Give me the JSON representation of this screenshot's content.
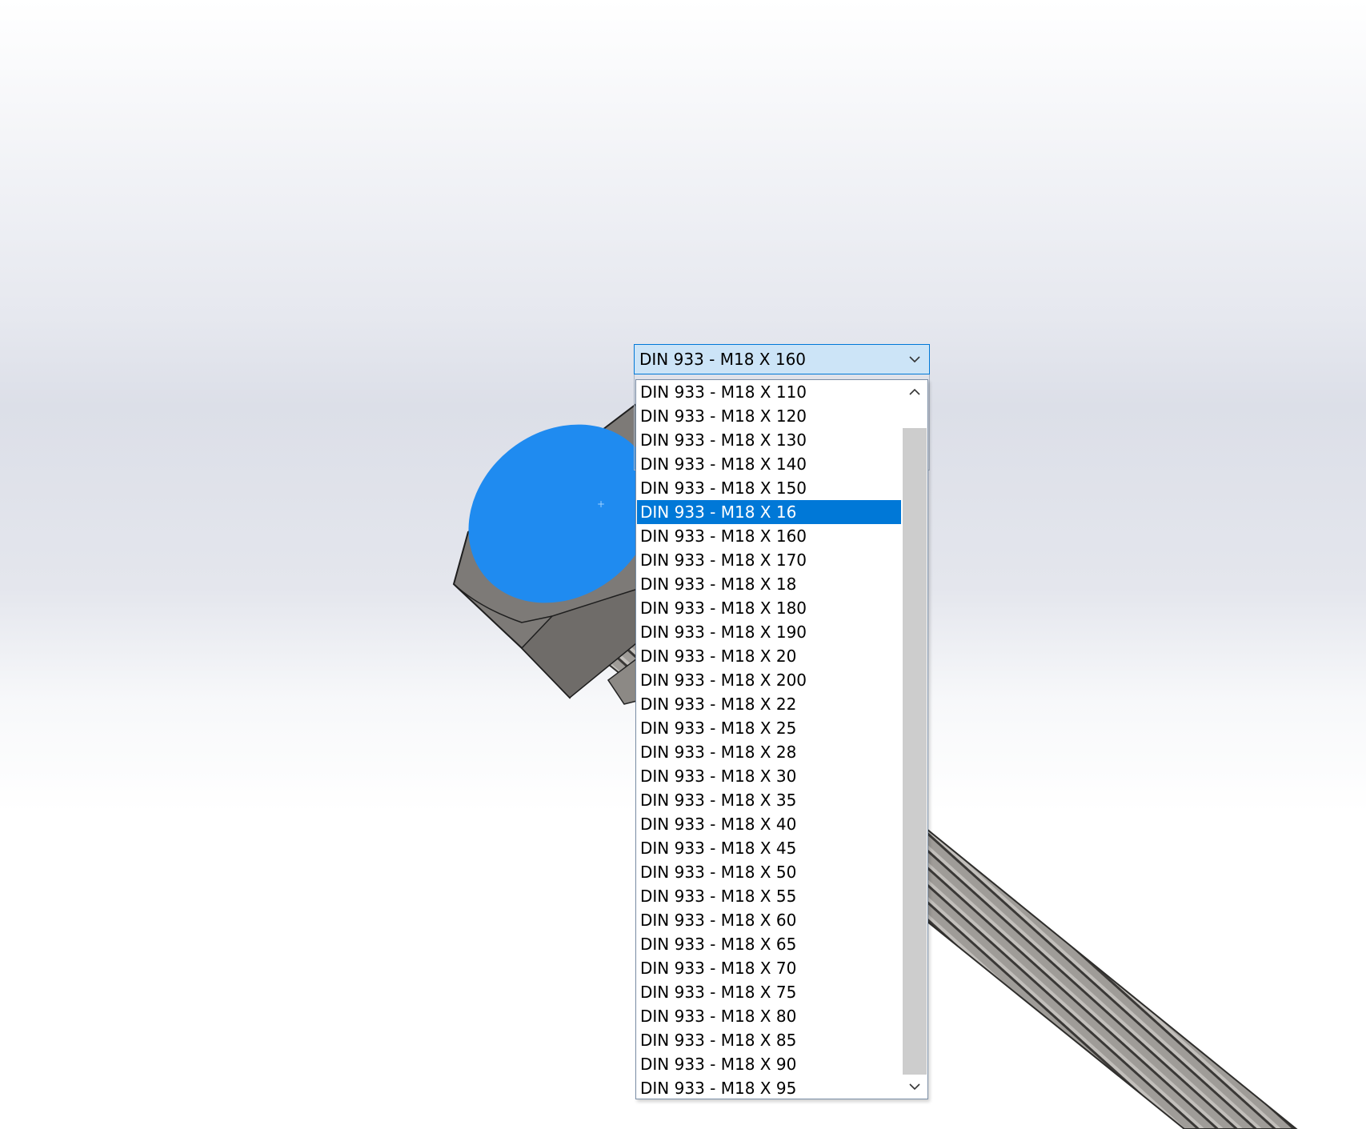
{
  "combo": {
    "selected_value": "DIN 933 - M18 X 160"
  },
  "dropdown": {
    "items": [
      "DIN 933 - M18 X 110",
      "DIN 933 - M18 X 120",
      "DIN 933 - M18 X 130",
      "DIN 933 - M18 X 140",
      "DIN 933 - M18 X 150",
      "DIN 933 - M18 X 16",
      "DIN 933 - M18 X 160",
      "DIN 933 - M18 X 170",
      "DIN 933 - M18 X 18",
      "DIN 933 - M18 X 180",
      "DIN 933 - M18 X 190",
      "DIN 933 - M18 X 20",
      "DIN 933 - M18 X 200",
      "DIN 933 - M18 X 22",
      "DIN 933 - M18 X 25",
      "DIN 933 - M18 X 28",
      "DIN 933 - M18 X 30",
      "DIN 933 - M18 X 35",
      "DIN 933 - M18 X 40",
      "DIN 933 - M18 X 45",
      "DIN 933 - M18 X 50",
      "DIN 933 - M18 X 55",
      "DIN 933 - M18 X 60",
      "DIN 933 - M18 X 65",
      "DIN 933 - M18 X 70",
      "DIN 933 - M18 X 75",
      "DIN 933 - M18 X 80",
      "DIN 933 - M18 X 85",
      "DIN 933 - M18 X 90",
      "DIN 933 - M18 X 95"
    ],
    "highlighted_index": 5,
    "scroll_position": 0.0
  },
  "icons": {
    "combo_arrow": "chevron-down-icon",
    "scroll_up": "chevron-up-icon",
    "scroll_down": "chevron-down-icon"
  },
  "colors": {
    "selection": "#0078d7",
    "combo_background": "#cce4f7",
    "bolt_face_highlight": "#1f8bf0",
    "bolt_metal": "#7d7a77",
    "scroll_thumb": "#cdcdcd"
  }
}
